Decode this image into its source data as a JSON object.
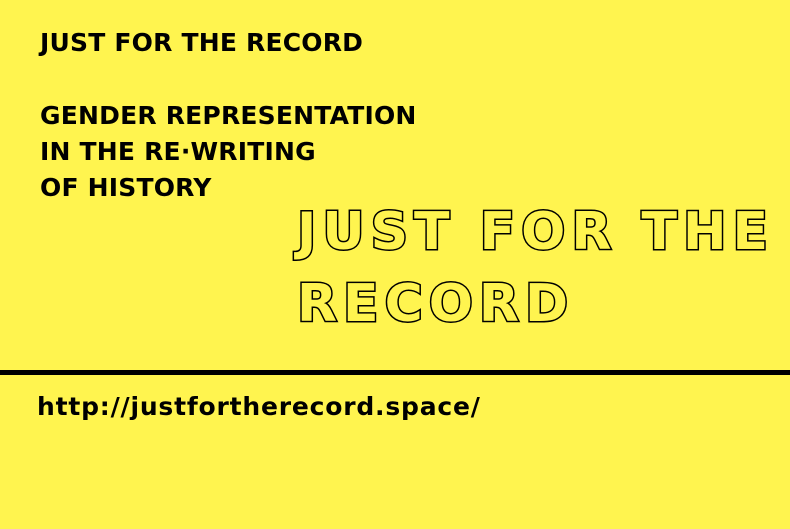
{
  "header": {
    "title": "JUST FOR THE RECORD"
  },
  "subtitle": {
    "lines": [
      "GENDER REPRESENTATION",
      "IN THE RE·WRITING",
      "OF HISTORY"
    ]
  },
  "logo": {
    "lines": [
      "JUST FOR THE",
      "RECORD"
    ]
  },
  "footer": {
    "url": "http://justfortherecord.space/"
  },
  "colors": {
    "background": "#fff44f",
    "text": "#000000"
  }
}
